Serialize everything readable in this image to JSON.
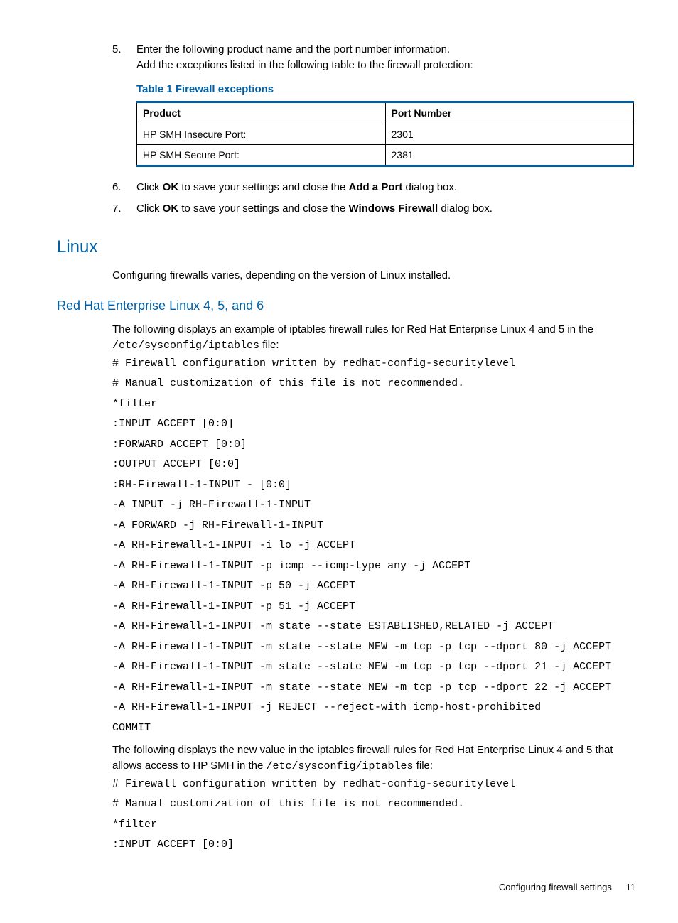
{
  "step5": {
    "num": "5.",
    "line1": "Enter the following product name and the port number information.",
    "line2": "Add the exceptions listed in the following table to the firewall protection:",
    "table_caption": "Table 1 Firewall exceptions",
    "th_product": "Product",
    "th_port": "Port Number",
    "rows": [
      {
        "product": "HP SMH Insecure Port:",
        "port": "2301"
      },
      {
        "product": "HP SMH Secure Port:",
        "port": "2381"
      }
    ]
  },
  "step6": {
    "num": "6.",
    "pre": "Click ",
    "btn": "OK",
    "mid": " to save your settings and close the ",
    "dlg": "Add a Port",
    "post": " dialog box."
  },
  "step7": {
    "num": "7.",
    "pre": "Click ",
    "btn": "OK",
    "mid": " to save your settings and close the ",
    "dlg": "Windows Firewall",
    "post": " dialog box."
  },
  "linux": {
    "heading": "Linux",
    "intro": "Configuring firewalls varies, depending on the version of Linux installed."
  },
  "rhel": {
    "heading": "Red Hat Enterprise Linux 4, 5, and 6",
    "intro_pre": "The following displays an example of iptables firewall rules for Red Hat Enterprise Linux 4 and 5 in the ",
    "intro_code": "/etc/sysconfig/iptables",
    "intro_post": " file:",
    "code1": "# Firewall configuration written by redhat-config-securitylevel\n# Manual customization of this file is not recommended.\n*filter\n:INPUT ACCEPT [0:0]\n:FORWARD ACCEPT [0:0]\n:OUTPUT ACCEPT [0:0]\n:RH-Firewall-1-INPUT - [0:0]\n-A INPUT -j RH-Firewall-1-INPUT\n-A FORWARD -j RH-Firewall-1-INPUT\n-A RH-Firewall-1-INPUT -i lo -j ACCEPT\n-A RH-Firewall-1-INPUT -p icmp --icmp-type any -j ACCEPT\n-A RH-Firewall-1-INPUT -p 50 -j ACCEPT\n-A RH-Firewall-1-INPUT -p 51 -j ACCEPT\n-A RH-Firewall-1-INPUT -m state --state ESTABLISHED,RELATED -j ACCEPT\n-A RH-Firewall-1-INPUT -m state --state NEW -m tcp -p tcp --dport 80 -j ACCEPT\n-A RH-Firewall-1-INPUT -m state --state NEW -m tcp -p tcp --dport 21 -j ACCEPT\n-A RH-Firewall-1-INPUT -m state --state NEW -m tcp -p tcp --dport 22 -j ACCEPT\n-A RH-Firewall-1-INPUT -j REJECT --reject-with icmp-host-prohibited\nCOMMIT",
    "mid_pre": "The following displays the new value in the iptables firewall rules for Red Hat Enterprise Linux 4 and 5 that allows access to HP SMH in the ",
    "mid_code": "/etc/sysconfig/iptables",
    "mid_post": " file:",
    "code2": "# Firewall configuration written by redhat-config-securitylevel\n# Manual customization of this file is not recommended.\n*filter\n:INPUT ACCEPT [0:0]"
  },
  "footer": {
    "text": "Configuring firewall settings",
    "page": "11"
  }
}
